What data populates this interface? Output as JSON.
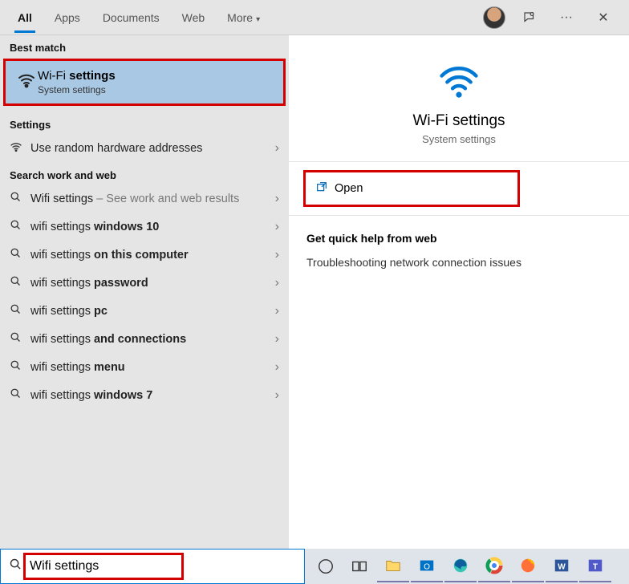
{
  "tabs": {
    "all": "All",
    "apps": "Apps",
    "documents": "Documents",
    "web": "Web",
    "more": "More"
  },
  "sections": {
    "best": "Best match",
    "settings": "Settings",
    "web": "Search work and web"
  },
  "best_match": {
    "title_pre": "Wi-Fi ",
    "title_bold": "settings",
    "subtitle": "System settings"
  },
  "settings_items": [
    {
      "label": "Use random hardware addresses"
    }
  ],
  "web_items": [
    {
      "pre": "Wifi settings",
      "bold": "",
      "suffix": " – See work and web results"
    },
    {
      "pre": "wifi settings ",
      "bold": "windows 10",
      "suffix": ""
    },
    {
      "pre": "wifi settings ",
      "bold": "on this computer",
      "suffix": ""
    },
    {
      "pre": "wifi settings ",
      "bold": "password",
      "suffix": ""
    },
    {
      "pre": "wifi settings ",
      "bold": "pc",
      "suffix": ""
    },
    {
      "pre": "wifi settings ",
      "bold": "and connections",
      "suffix": ""
    },
    {
      "pre": "wifi settings ",
      "bold": "menu",
      "suffix": ""
    },
    {
      "pre": "wifi settings ",
      "bold": "windows 7",
      "suffix": ""
    }
  ],
  "detail": {
    "title": "Wi-Fi settings",
    "subtitle": "System settings",
    "open": "Open"
  },
  "help": {
    "heading": "Get quick help from web",
    "line1": "Troubleshooting network connection issues"
  },
  "search": {
    "value": "Wifi settings"
  }
}
